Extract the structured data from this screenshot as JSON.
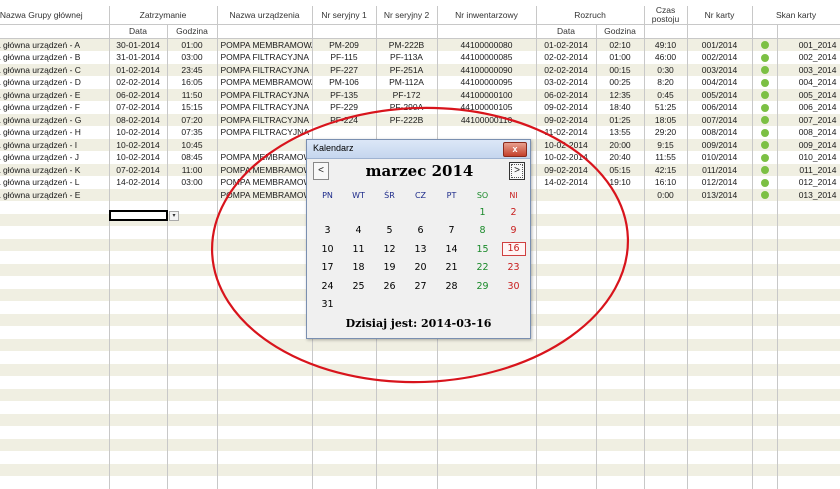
{
  "sheet": {
    "header_top": [
      "Nazwa Grupy głównej",
      "Zatrzymanie",
      "Nazwa urządzenia",
      "Nr seryjny 1",
      "Nr seryjny 2",
      "Nr inwentarzowy",
      "Rozruch",
      "Czas postoju",
      "Nr karty",
      "Skan karty"
    ],
    "header_sub": [
      "Data",
      "Godzina",
      "Data",
      "Godzina"
    ],
    "rows": [
      {
        "group": "Grupa główna urządzeń - A",
        "stop_date": "30-01-2014",
        "stop_time": "01:00",
        "device": "POMPA MEMBRAMOWA",
        "sn1": "PM-209",
        "sn2": "PM-222B",
        "inv": "44100000080",
        "start_date": "01-02-2014",
        "start_time": "02:10",
        "downtime": "49:10",
        "card": "001/2014",
        "scan": "001_2014"
      },
      {
        "group": "Grupa główna urządzeń - B",
        "stop_date": "31-01-2014",
        "stop_time": "03:00",
        "device": "POMPA FILTRACYJNA",
        "sn1": "PF-115",
        "sn2": "PF-113A",
        "inv": "44100000085",
        "start_date": "02-02-2014",
        "start_time": "01:00",
        "downtime": "46:00",
        "card": "002/2014",
        "scan": "002_2014"
      },
      {
        "group": "Grupa główna urządzeń - C",
        "stop_date": "01-02-2014",
        "stop_time": "23:45",
        "device": "POMPA FILTRACYJNA",
        "sn1": "PF-227",
        "sn2": "PF-251A",
        "inv": "44100000090",
        "start_date": "02-02-2014",
        "start_time": "00:15",
        "downtime": "0:30",
        "card": "003/2014",
        "scan": "003_2014"
      },
      {
        "group": "Grupa główna urządzeń - D",
        "stop_date": "02-02-2014",
        "stop_time": "16:05",
        "device": "POMPA MEMBRAMOWA",
        "sn1": "PM-106",
        "sn2": "PM-112A",
        "inv": "44100000095",
        "start_date": "03-02-2014",
        "start_time": "00:25",
        "downtime": "8:20",
        "card": "004/2014",
        "scan": "004_2014"
      },
      {
        "group": "Grupa główna urządzeń - E",
        "stop_date": "06-02-2014",
        "stop_time": "11:50",
        "device": "POMPA FILTRACYJNA",
        "sn1": "PF-135",
        "sn2": "PF-172",
        "inv": "44100000100",
        "start_date": "06-02-2014",
        "start_time": "12:35",
        "downtime": "0:45",
        "card": "005/2014",
        "scan": "005_2014"
      },
      {
        "group": "Grupa główna urządzeń - F",
        "stop_date": "07-02-2014",
        "stop_time": "15:15",
        "device": "POMPA FILTRACYJNA",
        "sn1": "PF-229",
        "sn2": "PF-290A",
        "inv": "44100000105",
        "start_date": "09-02-2014",
        "start_time": "18:40",
        "downtime": "51:25",
        "card": "006/2014",
        "scan": "006_2014"
      },
      {
        "group": "Grupa główna urządzeń - G",
        "stop_date": "08-02-2014",
        "stop_time": "07:20",
        "device": "POMPA FILTRACYJNA",
        "sn1": "PF-224",
        "sn2": "PF-222B",
        "inv": "44100000110",
        "start_date": "09-02-2014",
        "start_time": "01:25",
        "downtime": "18:05",
        "card": "007/2014",
        "scan": "007_2014"
      },
      {
        "group": "Grupa główna urządzeń - H",
        "stop_date": "10-02-2014",
        "stop_time": "07:35",
        "device": "POMPA FILTRACYJNA",
        "sn1": "",
        "sn2": "",
        "inv": "",
        "start_date": "11-02-2014",
        "start_time": "13:55",
        "downtime": "29:20",
        "card": "008/2014",
        "scan": "008_2014"
      },
      {
        "group": "Grupa główna urządzeń - I",
        "stop_date": "10-02-2014",
        "stop_time": "10:45",
        "device": "",
        "sn1": "",
        "sn2": "",
        "inv": "",
        "start_date": "10-02-2014",
        "start_time": "20:00",
        "downtime": "9:15",
        "card": "009/2014",
        "scan": "009_2014"
      },
      {
        "group": "Grupa główna urządzeń - J",
        "stop_date": "10-02-2014",
        "stop_time": "08:45",
        "device": "POMPA MEMBRAMOWA",
        "sn1": "",
        "sn2": "",
        "inv": "",
        "start_date": "10-02-2014",
        "start_time": "20:40",
        "downtime": "11:55",
        "card": "010/2014",
        "scan": "010_2014"
      },
      {
        "group": "Grupa główna urządzeń - K",
        "stop_date": "07-02-2014",
        "stop_time": "11:00",
        "device": "POMPA MEMBRAMOWA",
        "sn1": "",
        "sn2": "",
        "inv": "",
        "start_date": "09-02-2014",
        "start_time": "05:15",
        "downtime": "42:15",
        "card": "011/2014",
        "scan": "011_2014"
      },
      {
        "group": "Grupa główna urządzeń - L",
        "stop_date": "14-02-2014",
        "stop_time": "03:00",
        "device": "POMPA MEMBRAMOWA",
        "sn1": "",
        "sn2": "",
        "inv": "",
        "start_date": "14-02-2014",
        "start_time": "19:10",
        "downtime": "16:10",
        "card": "012/2014",
        "scan": "012_2014"
      },
      {
        "group": "Grupa główna urządzeń - E",
        "stop_date": "",
        "stop_time": "",
        "device": "POMPA MEMBRAMOWA",
        "sn1": "",
        "sn2": "",
        "inv": "",
        "start_date": "",
        "start_time": "",
        "downtime": "0:00",
        "card": "013/2014",
        "scan": "013_2014"
      }
    ],
    "dropdown_arrow": "▾"
  },
  "dialog": {
    "title": "Kalendarz",
    "close": "x",
    "prev": "<",
    "next": ">",
    "month": "marzec 2014",
    "weekdays": [
      "PN",
      "WT",
      "ŚR",
      "CZ",
      "PT",
      "SO",
      "NI"
    ],
    "weeks": [
      [
        "",
        "",
        "",
        "",
        "",
        "1",
        "2"
      ],
      [
        "3",
        "4",
        "5",
        "6",
        "7",
        "8",
        "9"
      ],
      [
        "10",
        "11",
        "12",
        "13",
        "14",
        "15",
        "16"
      ],
      [
        "17",
        "18",
        "19",
        "20",
        "21",
        "22",
        "23"
      ],
      [
        "24",
        "25",
        "26",
        "27",
        "28",
        "29",
        "30"
      ],
      [
        "31",
        "",
        "",
        "",
        "",
        "",
        ""
      ]
    ],
    "today_label": "Dzisiaj jest: 2014-03-16",
    "today_day": "16"
  },
  "colors": {
    "status_green": "#7cc043",
    "annotation_red": "#d8141c",
    "weekend_sat": "#1a8a2a",
    "weekend_sun": "#c81e1e"
  }
}
